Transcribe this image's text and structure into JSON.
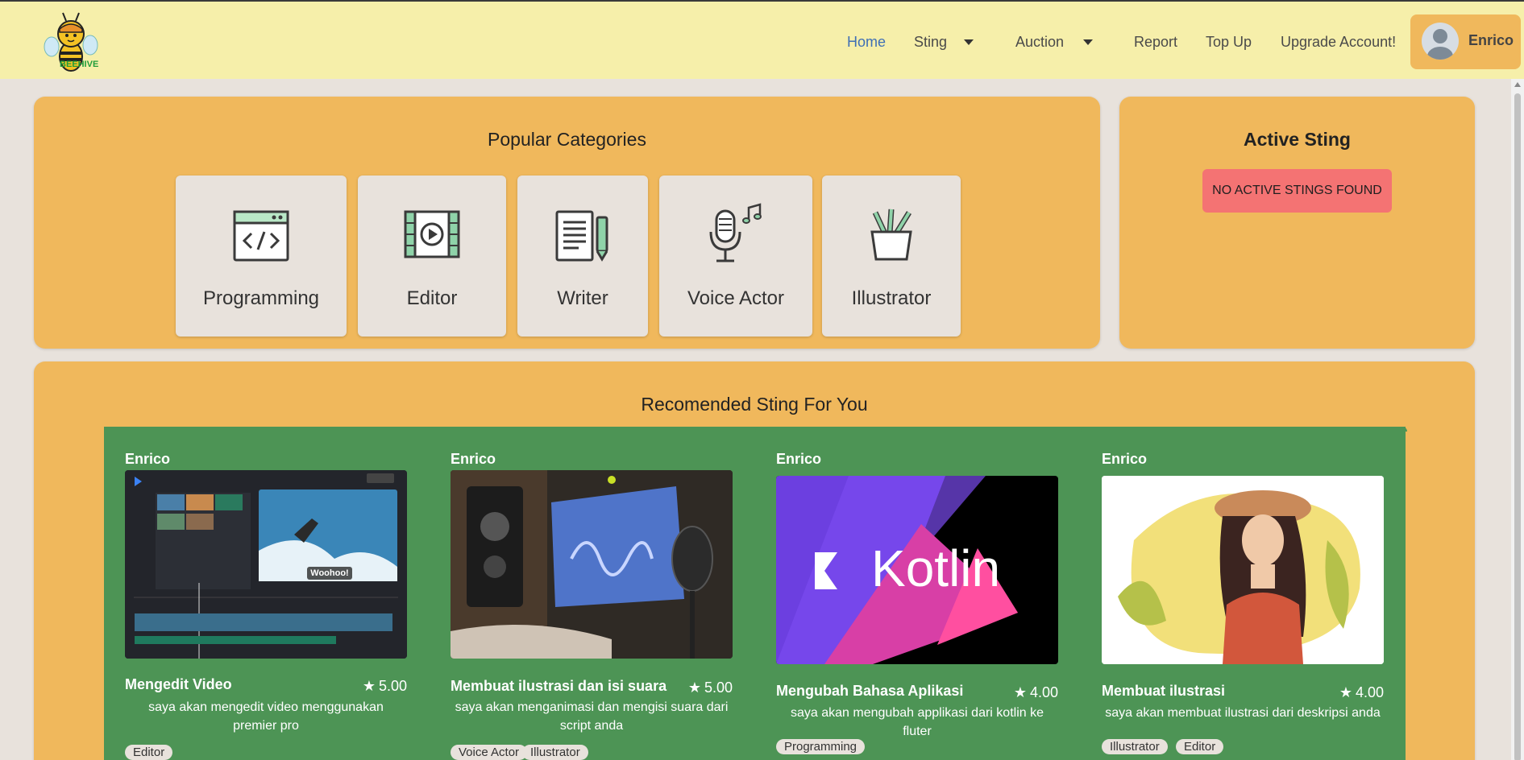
{
  "nav": {
    "brand": "BEEHIVE",
    "home": "Home",
    "sting": "Sting",
    "auction": "Auction",
    "report": "Report",
    "top_up": "Top Up",
    "upgrade": "Upgrade Account!",
    "user": "Enrico"
  },
  "popular": {
    "title": "Popular Categories",
    "categories": [
      {
        "label": "Programming",
        "icon": "code-window-icon"
      },
      {
        "label": "Editor",
        "icon": "video-film-icon"
      },
      {
        "label": "Writer",
        "icon": "document-pen-icon"
      },
      {
        "label": "Voice Actor",
        "icon": "microphone-icon"
      },
      {
        "label": "Illustrator",
        "icon": "pencil-cup-icon"
      }
    ]
  },
  "active": {
    "title": "Active Sting",
    "empty_message": "NO ACTIVE STINGS FOUND"
  },
  "recommended": {
    "title": "Recomended Sting For You",
    "items": [
      {
        "seller": "Enrico",
        "title": "Mengedit Video",
        "rating": "5.00",
        "description": "saya akan mengedit video menggunakan premier pro",
        "tags": [
          "Editor"
        ],
        "thumb_overlay": "Woohoo!"
      },
      {
        "seller": "Enrico",
        "title": "Membuat ilustrasi dan isi suara",
        "rating": "5.00",
        "description": "saya akan menganimasi dan mengisi suara dari script anda",
        "tags": [
          "Voice Actor",
          "Illustrator"
        ]
      },
      {
        "seller": "Enrico",
        "title": "Mengubah Bahasa Aplikasi",
        "rating": "4.00",
        "description": "saya akan mengubah applikasi dari kotlin ke fluter",
        "tags": [
          "Programming"
        ],
        "thumb_overlay": "Kotlin"
      },
      {
        "seller": "Enrico",
        "title": "Membuat ilustrasi",
        "rating": "4.00",
        "description": "saya akan membuat ilustrasi dari deskripsi anda",
        "tags": [
          "Illustrator",
          "Editor"
        ]
      }
    ]
  },
  "colors": {
    "navbar": "#f6efaa",
    "panel": "#f0b85c",
    "card_green": "#4d9455",
    "alert_red": "#f47373",
    "nav_active": "#3f6fb5"
  }
}
